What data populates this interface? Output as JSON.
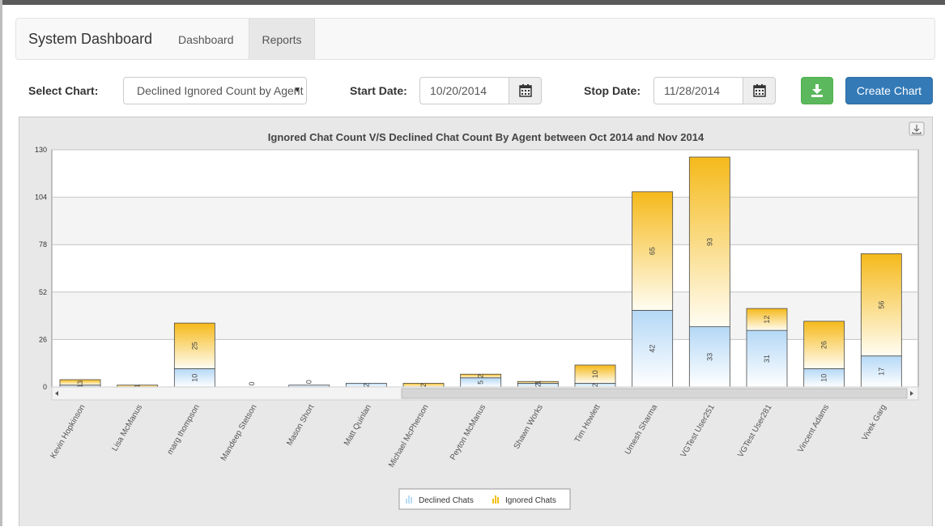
{
  "navbar": {
    "brand": "System Dashboard",
    "links": [
      {
        "label": "Dashboard",
        "active": false
      },
      {
        "label": "Reports",
        "active": true
      }
    ]
  },
  "controls": {
    "select_chart_label": "Select Chart:",
    "select_chart_value": "Declined Ignored Count by Agent",
    "start_date_label": "Start Date:",
    "start_date_value": "10/20/2014",
    "stop_date_label": "Stop Date:",
    "stop_date_value": "11/28/2014",
    "download_icon": "download-icon",
    "calendar_icon": "calendar-icon",
    "create_chart_label": "Create Chart"
  },
  "colors": {
    "declined": "#b8dcf8",
    "ignored": "#f5be16",
    "primary": "#337ab7",
    "success": "#5cb85c"
  },
  "chart_data": {
    "type": "bar",
    "stacked": true,
    "title": "Ignored Chat Count V/S Declined Chat Count By Agent between Oct 2014 and Nov 2014",
    "ylim": [
      0,
      130
    ],
    "yticks": [
      "0",
      "26",
      "52",
      "78",
      "104",
      "130"
    ],
    "categories": [
      "Kevin Hopkinson",
      "Lisa McManus",
      "marg thompson",
      "Mandeep Stetson",
      "Mason Short",
      "Matt Quinlan",
      "Michael McPherson",
      "Peyton McManus",
      "Shawn Works",
      "Tim Howlett",
      "Umesh Sharma",
      "VGTest User251",
      "VGTest User281",
      "Vincent Adams",
      "Vivek Garg"
    ],
    "series": [
      {
        "name": "Declined Chats",
        "values": [
          1,
          0,
          10,
          0,
          1,
          2,
          0,
          5,
          2,
          2,
          42,
          33,
          31,
          10,
          17
        ]
      },
      {
        "name": "Ignored Chats",
        "values": [
          3,
          1,
          25,
          0,
          0,
          0,
          2,
          2,
          1,
          10,
          65,
          93,
          12,
          26,
          56
        ]
      }
    ],
    "data_labels": {
      "declined": [
        "1",
        "",
        "10",
        "",
        "",
        "2",
        "",
        "5",
        "2",
        "2",
        "42",
        "33",
        "31",
        "10",
        "17"
      ],
      "ignored": [
        "3",
        "1",
        "25",
        "0",
        "0",
        "",
        "2",
        "2",
        "1",
        "10",
        "65",
        "93",
        "12",
        "26",
        "56"
      ]
    },
    "legend": {
      "position": "bottom-center",
      "items": [
        "Declined Chats",
        "Ignored Chats"
      ]
    },
    "grid": true,
    "export_icon": "export-icon"
  }
}
